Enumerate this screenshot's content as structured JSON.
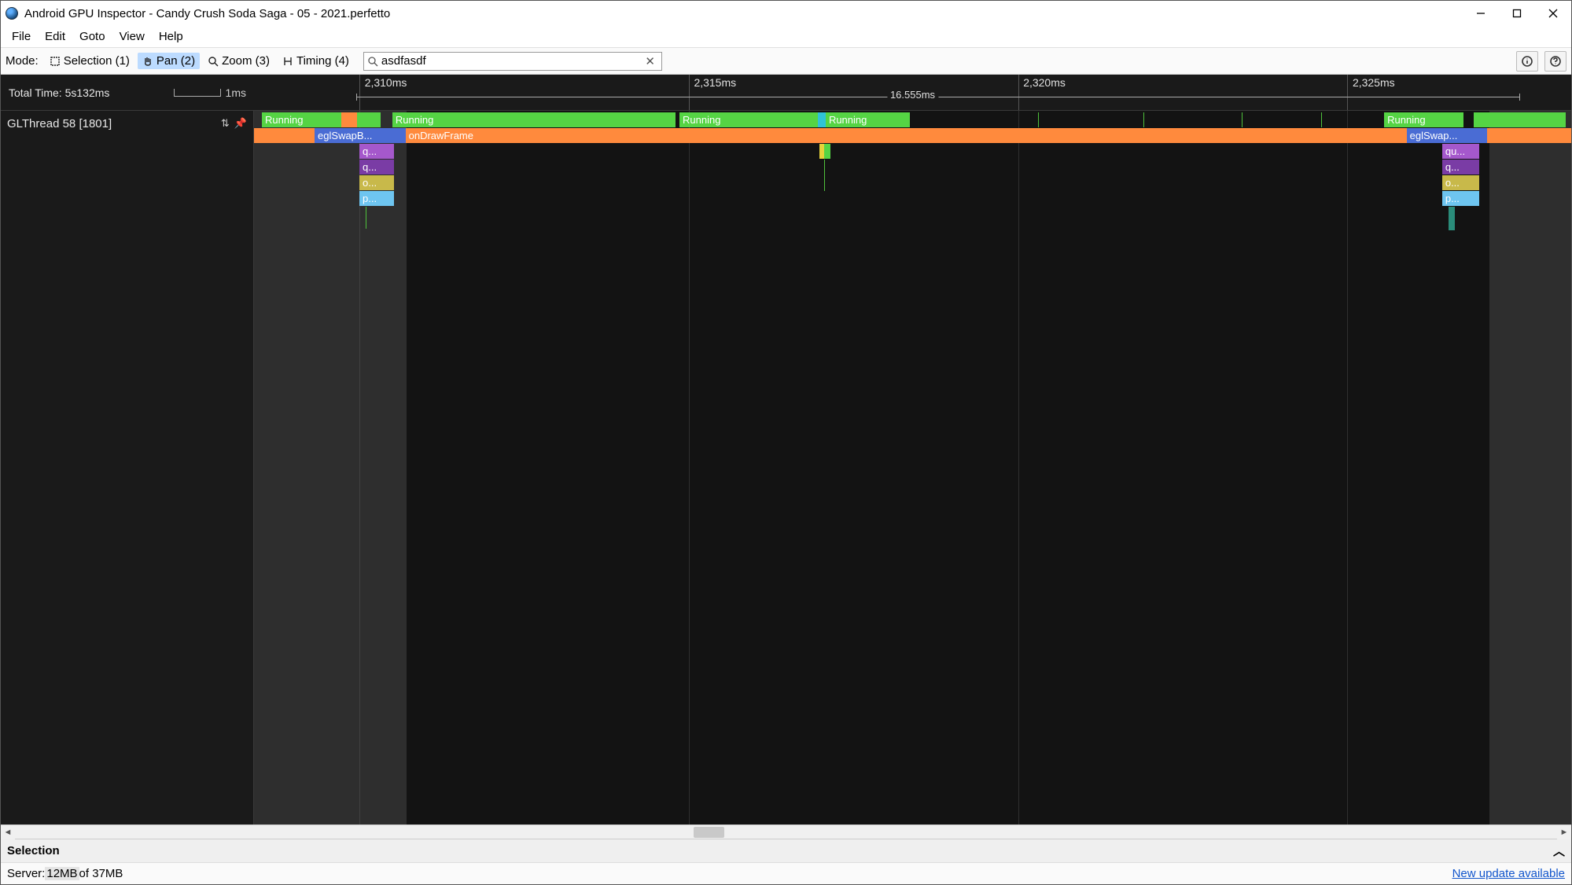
{
  "window": {
    "title": "Android GPU Inspector - Candy Crush Soda Saga - 05 - 2021.perfetto"
  },
  "menubar": [
    "File",
    "Edit",
    "Goto",
    "View",
    "Help"
  ],
  "toolbar": {
    "mode_label": "Mode:",
    "modes": {
      "selection": "Selection (1)",
      "pan": "Pan (2)",
      "zoom": "Zoom (3)",
      "timing": "Timing (4)"
    },
    "search_value": "asdfasdf"
  },
  "timeline": {
    "total_time_label": "Total Time: 5s132ms",
    "scale_unit": "1ms",
    "tick_labels": [
      "2,310ms",
      "2,315ms",
      "2,320ms",
      "2,325ms"
    ],
    "selection_span_label": "16.555ms",
    "track_name": "GLThread 58 [1801]",
    "slice_labels": {
      "running": "Running",
      "eglswap": "eglSwapB...",
      "eglswap2": "eglSwap...",
      "ondraw": "onDrawFrame",
      "q": "q...",
      "qu": "qu...",
      "o": "o...",
      "p": "p..."
    }
  },
  "selection_panel": {
    "title": "Selection"
  },
  "statusbar": {
    "server_label": "Server: ",
    "mem_used": "12MB",
    "mem_rest": " of 37MB",
    "update_link": "New update available"
  }
}
